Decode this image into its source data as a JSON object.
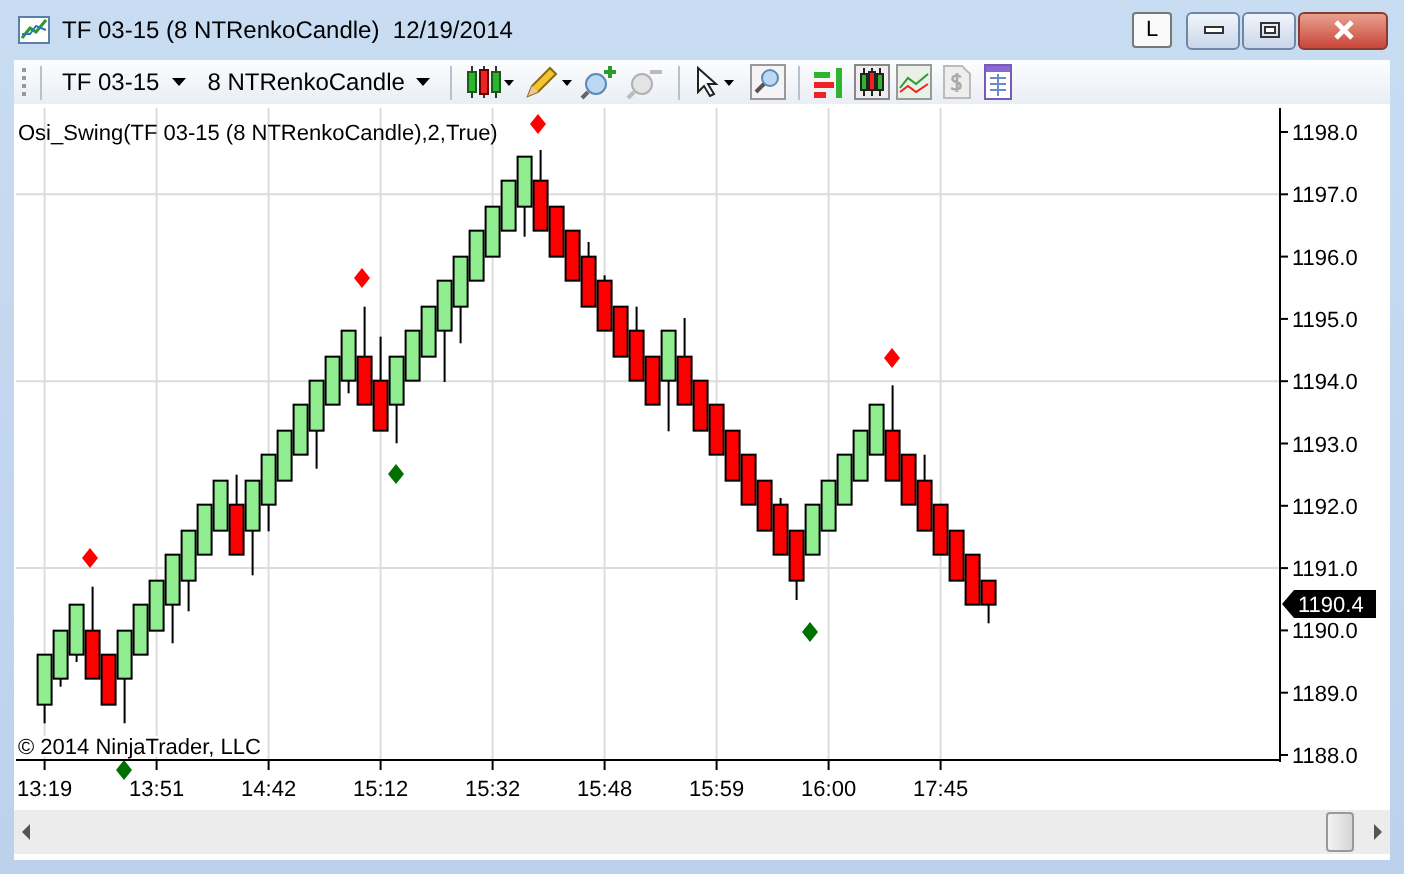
{
  "window": {
    "title": "TF 03-15 (8 NTRenkoCandle)  12/19/2014",
    "layout_button": "L"
  },
  "toolbar": {
    "instrument": "TF 03-15",
    "period": "8 NTRenkoCandle"
  },
  "chart": {
    "indicator": "Osi_Swing(TF 03-15 (8 NTRenkoCandle),2,True)",
    "copyright": "© 2014 NinjaTrader, LLC",
    "y_axis": [
      "1198.0",
      "1197.0",
      "1196.0",
      "1195.0",
      "1194.0",
      "1193.0",
      "1192.0",
      "1191.0",
      "1190.0",
      "1189.0",
      "1188.0"
    ],
    "x_axis": [
      "13:19",
      "13:51",
      "14:42",
      "15:12",
      "15:32",
      "15:48",
      "15:59",
      "16:00",
      "17:45"
    ],
    "last_price": "1190.4"
  }
}
